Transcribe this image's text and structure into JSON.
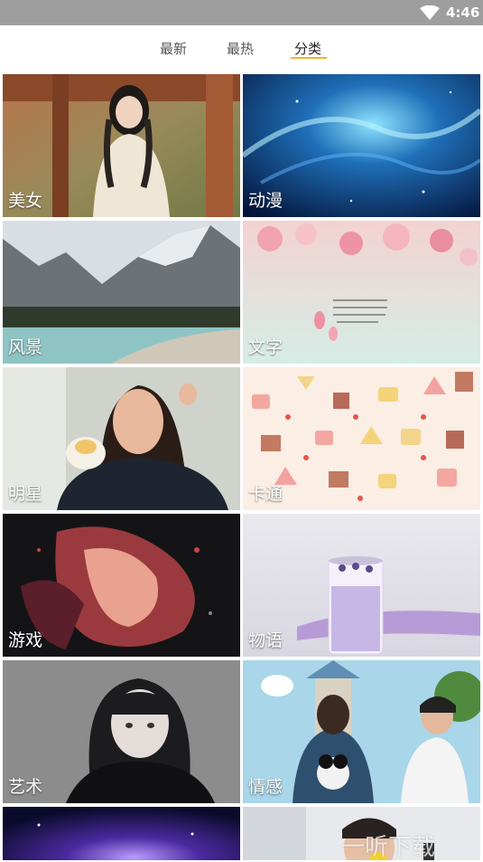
{
  "status_bar": {
    "time": "4:46",
    "icons": [
      "wifi-icon"
    ],
    "background": "#9e9e9e"
  },
  "tabs": [
    {
      "label": "最新",
      "active": false
    },
    {
      "label": "最热",
      "active": false
    },
    {
      "label": "分类",
      "active": true
    }
  ],
  "accent_color": "#f3b620",
  "categories": [
    {
      "label": "美女"
    },
    {
      "label": "动漫"
    },
    {
      "label": "风景"
    },
    {
      "label": "文字"
    },
    {
      "label": "明星"
    },
    {
      "label": "卡通"
    },
    {
      "label": "游戏"
    },
    {
      "label": "物语"
    },
    {
      "label": "艺术"
    },
    {
      "label": "情感"
    }
  ],
  "watermark": "一听下载"
}
